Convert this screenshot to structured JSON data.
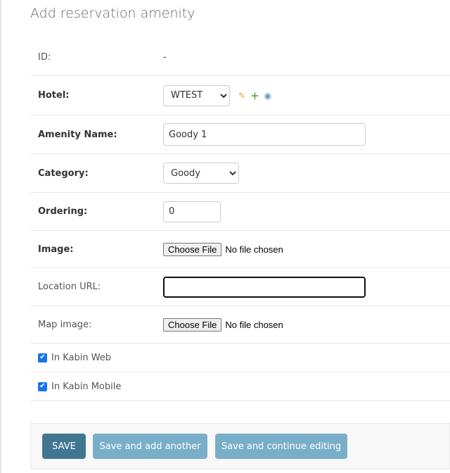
{
  "page": {
    "title": "Add reservation amenity"
  },
  "fields": {
    "id": {
      "label": "ID:",
      "value": "-"
    },
    "hotel": {
      "label": "Hotel:",
      "selected": "WTEST"
    },
    "amenity_name": {
      "label": "Amenity Name:",
      "value": "Goody 1"
    },
    "category": {
      "label": "Category:",
      "selected": "Goody"
    },
    "ordering": {
      "label": "Ordering:",
      "value": "0"
    },
    "image": {
      "label": "Image:",
      "button": "Choose File",
      "status": "No file chosen"
    },
    "location_url": {
      "label": "Location URL:",
      "value": ""
    },
    "map_image": {
      "label": "Map image:",
      "button": "Choose File",
      "status": "No file chosen"
    },
    "in_kabin_web": {
      "label": "In Kabin Web",
      "checked": true
    },
    "in_kabin_mobile": {
      "label": "In Kabin Mobile",
      "checked": true
    }
  },
  "icons": {
    "hotel_change": "pencil-icon",
    "hotel_add": "plus-icon",
    "hotel_view": "eye-icon",
    "checkbox": "check-icon"
  },
  "submit": {
    "save": "SAVE",
    "save_add_another": "Save and add another",
    "save_continue": "Save and continue editing"
  },
  "colors": {
    "primary_button": "#417690",
    "secondary_button": "#79aec8",
    "checkbox": "#1a73e8"
  }
}
